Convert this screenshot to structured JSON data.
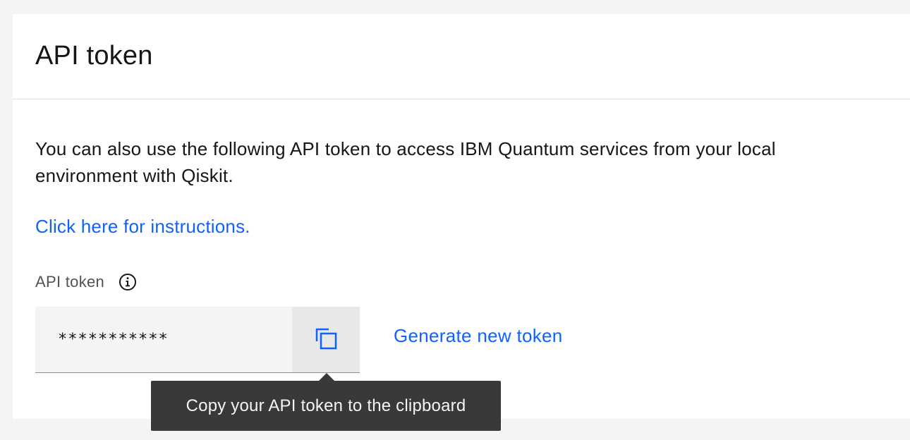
{
  "card": {
    "title": "API token",
    "description": "You can also use the following API token to access IBM Quantum services from your local environment with Qiskit.",
    "instructions_link": "Click here for instructions."
  },
  "token_field": {
    "label": "API token",
    "label_icon": "information-icon",
    "value": "***********",
    "copy_icon": "copy-icon"
  },
  "actions": {
    "generate_link": "Generate new token"
  },
  "tooltip": {
    "text": "Copy your API token to the clipboard"
  },
  "colors": {
    "link": "#0f62fe",
    "tooltip_bg": "#393939",
    "field_bg": "#f4f4f4",
    "page_bg": "#f4f4f4"
  }
}
